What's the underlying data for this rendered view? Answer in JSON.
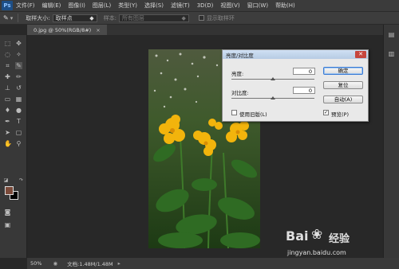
{
  "app": {
    "logo": "Ps"
  },
  "menu": [
    "文件(F)",
    "编辑(E)",
    "图像(I)",
    "图层(L)",
    "类型(Y)",
    "选择(S)",
    "滤镜(T)",
    "3D(D)",
    "视图(V)",
    "窗口(W)",
    "帮助(H)"
  ],
  "options": {
    "sample_size_label": "取样大小:",
    "sample_size_value": "取样点",
    "sample_label": "样本:",
    "sample_value": "所有图层",
    "show_ring_label": "显示取样环"
  },
  "document": {
    "tab_title": "0.jpg @ 50%(RGB/8#)",
    "zoom": "50%",
    "doc_info": "文档:1.48M/1.48M"
  },
  "dialog": {
    "title": "亮度/对比度",
    "brightness_label": "亮度:",
    "brightness_value": "0",
    "contrast_label": "对比度:",
    "contrast_value": "0",
    "legacy_label": "使用旧版(L)",
    "legacy_checked": false,
    "ok_label": "确定",
    "reset_label": "复位",
    "auto_label": "自动(A)",
    "preview_label": "预览(P)",
    "preview_checked": true
  },
  "colors": {
    "foreground": "#7b4a3a",
    "background": "#000000",
    "accent": "#1d4e86"
  },
  "watermark": {
    "brand": "Bai",
    "brand_suffix": "经验",
    "url": "jingyan.baidu.com"
  }
}
